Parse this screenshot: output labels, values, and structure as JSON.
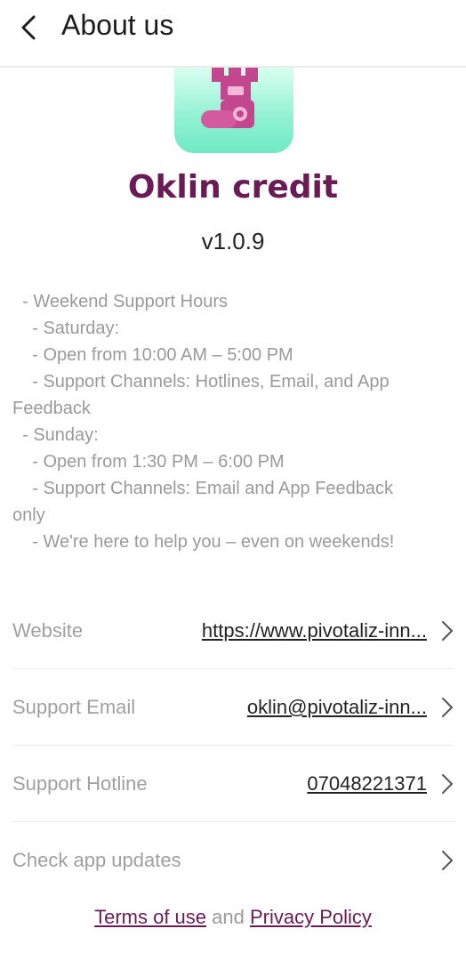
{
  "header": {
    "title": "About us"
  },
  "app": {
    "name": "Oklin credit",
    "version": "v1.0.9"
  },
  "support_text": [
    "  - Weekend Support Hours",
    "    - Saturday:",
    "    - Open from 10:00 AM – 5:00 PM",
    "    - Support Channels: Hotlines, Email, and App",
    "Feedback",
    "  - Sunday:",
    "    - Open from 1:30 PM – 6:00 PM",
    "    - Support Channels: Email and App Feedback",
    "only",
    "    - We're here to help you – even on weekends!"
  ],
  "rows": [
    {
      "label": "Website",
      "value": "https://www.pivotaliz-inn..."
    },
    {
      "label": "Support Email",
      "value": "oklin@pivotaliz-inn..."
    },
    {
      "label": "Support Hotline",
      "value": "07048221371"
    },
    {
      "label": "Check app updates",
      "value": ""
    }
  ],
  "footer": {
    "terms": "Terms of use",
    "and": "and",
    "privacy": "Privacy Policy"
  },
  "colors": {
    "brand": "#6a1b55",
    "logo_bg": "#8ff1d2",
    "logo_fg": "#c2478f"
  },
  "icons": {
    "back": "chevron-left-icon",
    "row": "chevron-right-icon",
    "logo": "castle-scroll-icon"
  }
}
